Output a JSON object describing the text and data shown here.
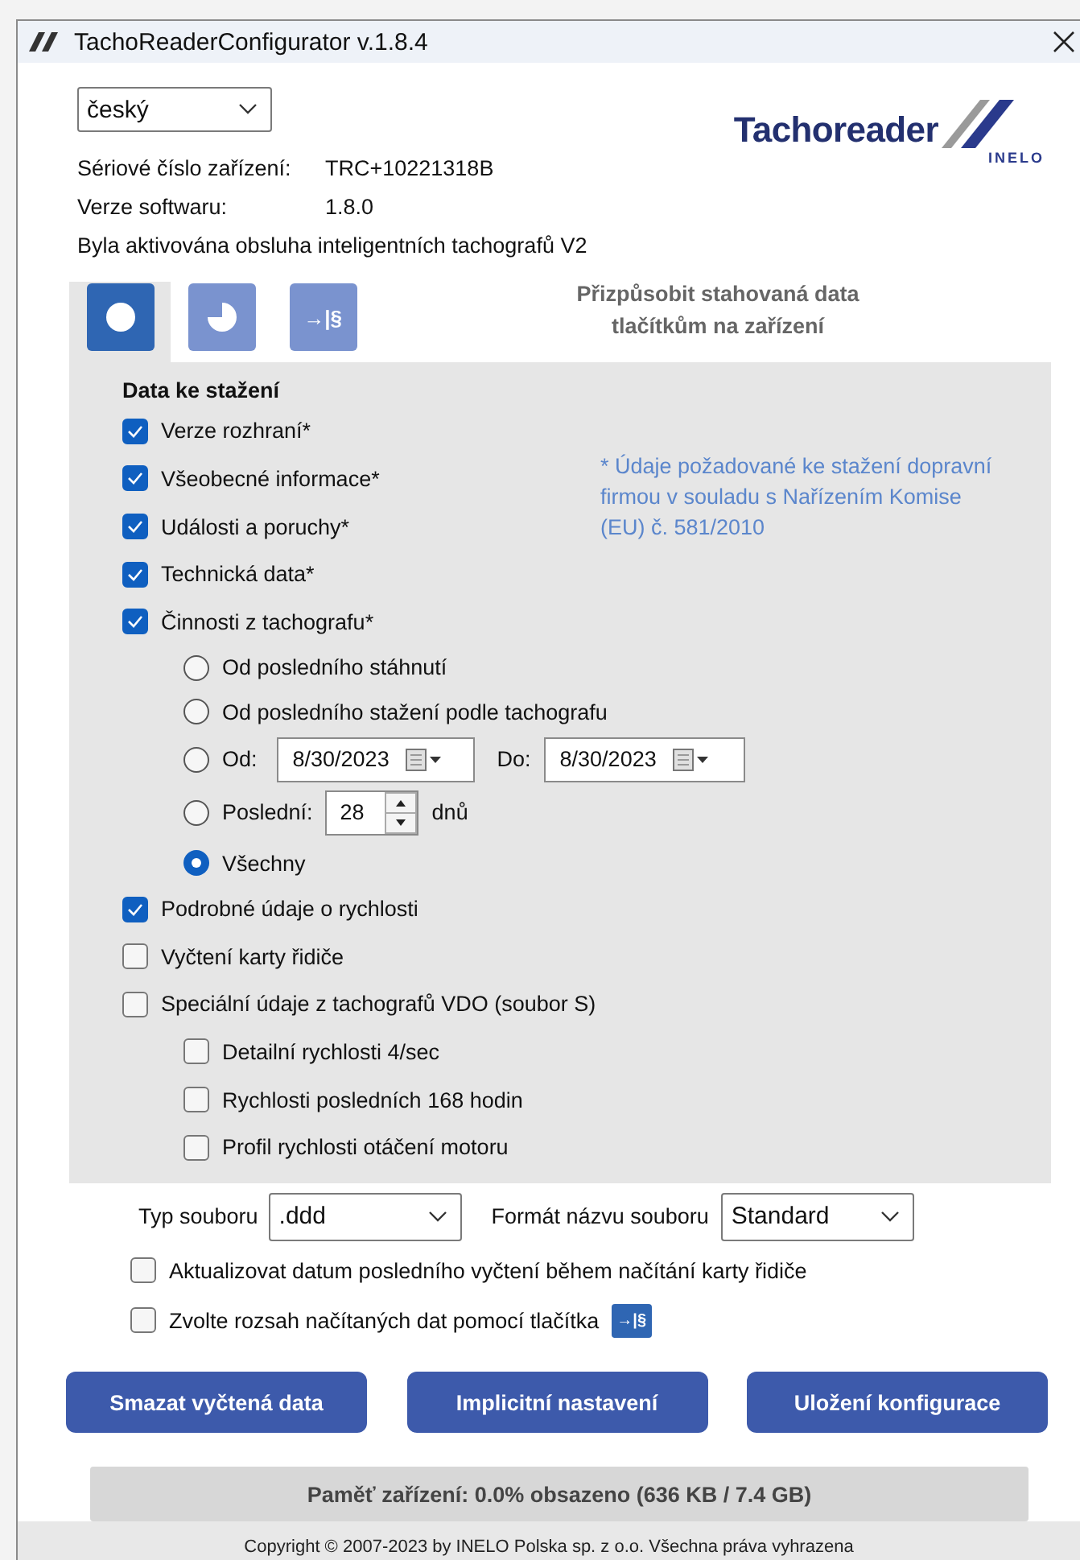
{
  "window": {
    "title": "TachoReaderConfigurator v.1.8.4"
  },
  "language": {
    "value": "český"
  },
  "logo": {
    "name": "Tachoreader",
    "sub": "INELO"
  },
  "info": [
    {
      "label": "Sériové číslo zařízení:",
      "value": "TRC+10221318B"
    },
    {
      "label": "Verze softwaru:",
      "value": "1.8.0"
    }
  ],
  "notice": "Byla aktivována obsluha inteligentních tachografů V2",
  "tabs": [
    {
      "kind": "record",
      "selected": true
    },
    {
      "kind": "pie",
      "selected": false
    },
    {
      "kind": "custom",
      "label": "→|§",
      "selected": false
    }
  ],
  "tabs_caption": "Přizpůsobit stahovaná data tlačítkům na zařízení",
  "data_section": {
    "title": "Data ke stažení",
    "note": "* Údaje požadované ke stažení dopravní firmou v souladu s Nařízením Komise (EU) č. 581/2010",
    "items": [
      {
        "label": "Verze rozhraní*",
        "checked": true
      },
      {
        "label": "Všeobecné informace*",
        "checked": true
      },
      {
        "label": "Události a poruchy*",
        "checked": true
      },
      {
        "label": "Technická data*",
        "checked": true
      },
      {
        "label": "Činnosti z tachografu*",
        "checked": true,
        "children": [
          {
            "kind": "radio",
            "label": "Od posledního stáhnutí",
            "selected": false
          },
          {
            "kind": "radio",
            "label": "Od posledního stažení podle tachografu",
            "selected": false
          },
          {
            "kind": "range",
            "label": "Od:",
            "from": "8/30/2023",
            "to_label": "Do:",
            "to": "8/30/2023",
            "selected": false
          },
          {
            "kind": "days",
            "label": "Poslední:",
            "value": "28",
            "unit": "dnů",
            "selected": false
          },
          {
            "kind": "radio",
            "label": "Všechny",
            "selected": true
          }
        ]
      },
      {
        "label": "Podrobné údaje o rychlosti",
        "checked": true
      },
      {
        "label": "Vyčtení karty řidiče",
        "checked": false
      },
      {
        "label": "Speciální údaje z tachografů VDO (soubor S)",
        "checked": false,
        "children": [
          {
            "kind": "checkbox",
            "label": "Detailní rychlosti 4/sec",
            "checked": false
          },
          {
            "kind": "checkbox",
            "label": "Rychlosti posledních 168 hodin",
            "checked": false
          },
          {
            "kind": "checkbox",
            "label": "Profil rychlosti otáčení motoru",
            "checked": false
          }
        ]
      }
    ]
  },
  "file_options": [
    {
      "label": "Typ souboru",
      "value": ".ddd"
    },
    {
      "label": "Formát názvu souboru",
      "value": "Standard"
    }
  ],
  "options": [
    {
      "label": "Aktualizovat datum posledního vyčtení během načítání karty řidiče",
      "checked": false
    },
    {
      "label": "Zvolte rozsah načítaných dat pomocí tlačítka",
      "checked": false,
      "button": "→|§"
    }
  ],
  "buttons": [
    "Smazat vyčtená data",
    "Implicitní nastavení",
    "Uložení konfigurace"
  ],
  "memory": "Paměť zařízení: 0.0% obsazeno (636 KB / 7.4 GB)",
  "copyright": "Copyright © 2007-2023 by INELO Polska sp. z o.o. Všechna práva vyhrazena"
}
